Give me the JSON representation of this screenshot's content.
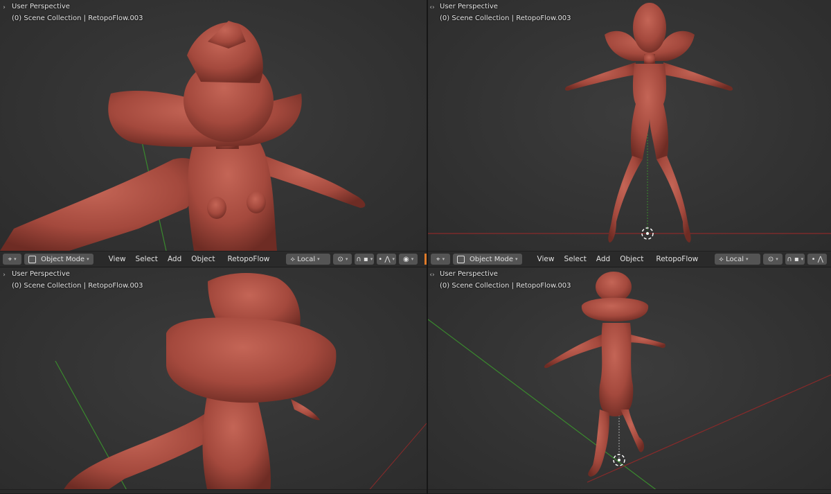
{
  "viewports": [
    {
      "id": "top-left",
      "title": "User Perspective",
      "subtitle": "(0) Scene Collection | RetopoFlow.003"
    },
    {
      "id": "top-right",
      "title": "User Perspective",
      "subtitle": "(0) Scene Collection | RetopoFlow.003"
    },
    {
      "id": "bottom-left",
      "title": "User Perspective",
      "subtitle": "(0) Scene Collection | RetopoFlow.003"
    },
    {
      "id": "bottom-right",
      "title": "User Perspective",
      "subtitle": "(0) Scene Collection | RetopoFlow.003"
    }
  ],
  "header": {
    "mode_label": "Object Mode",
    "menus": [
      "View",
      "Select",
      "Add",
      "Object",
      "RetopoFlow"
    ],
    "transform_orientation": "Local"
  },
  "colors": {
    "model": "#a4493d",
    "x_axis": "#8a2a2a",
    "y_axis": "#3a8a2e",
    "viewport_bg": "#383838",
    "header_bg": "#2a2a2a",
    "accent": "#e07b2a"
  },
  "icons": {
    "editor_type": "cursor-view-icon",
    "collapse": "chevron-right-icon",
    "pivot": "pivot-icon",
    "snap": "magnet-icon",
    "proportional": "falloff-icon",
    "visibility": "eye-icon"
  }
}
